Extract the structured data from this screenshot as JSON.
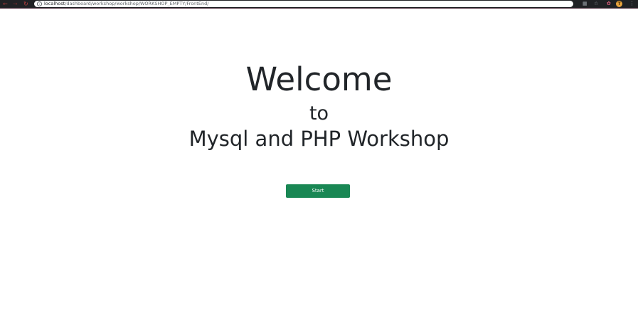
{
  "browser": {
    "url_host": "localhost",
    "url_path": "/dashboard/workshop/workshop/WORKSHOP_EMPTY/FrontEnd/",
    "avatar_letter": "T",
    "icons": {
      "back": "back-arrow-icon",
      "forward": "forward-arrow-icon",
      "reload": "reload-icon",
      "info": "info-icon",
      "translate": "translate-icon",
      "bookmark": "star-icon",
      "extension": "extension-icon",
      "menu": "kebab-menu-icon"
    }
  },
  "page": {
    "heading_welcome": "Welcome",
    "heading_to": "to",
    "heading_workshop": "Mysql and PHP Workshop",
    "start_button": "Start"
  },
  "colors": {
    "button_bg": "#198754",
    "text": "#212529",
    "browser_bar": "#202124"
  }
}
